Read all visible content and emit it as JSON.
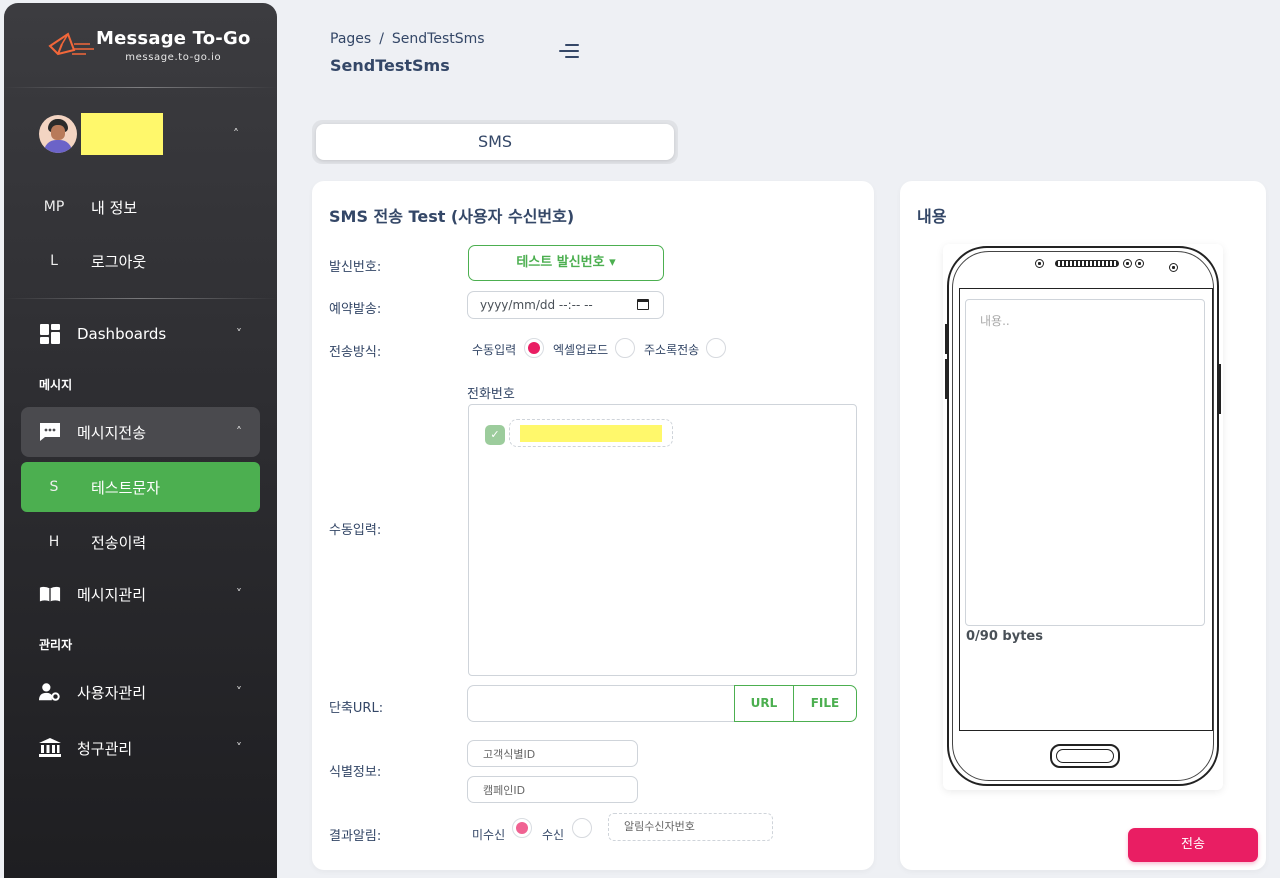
{
  "brand": {
    "title": "Message To-Go",
    "subtitle": "message.to-go.io"
  },
  "sidebar": {
    "user_subitems": [
      {
        "abbr": "MP",
        "label": "내 정보"
      },
      {
        "abbr": "L",
        "label": "로그아웃"
      }
    ],
    "dashboards": "Dashboards",
    "section_message": "메시지",
    "message_send": "메시지전송",
    "message_send_subitems": [
      {
        "abbr": "S",
        "label": "테스트문자"
      },
      {
        "abbr": "H",
        "label": "전송이력"
      }
    ],
    "message_manage": "메시지관리",
    "section_admin": "관리자",
    "user_manage": "사용자관리",
    "billing_manage": "청구관리"
  },
  "header": {
    "breadcrumb_root": "Pages",
    "breadcrumb_sep": "/",
    "breadcrumb_current": "SendTestSms",
    "title": "SendTestSms"
  },
  "tabs": [
    "SMS"
  ],
  "form": {
    "title": "SMS 전송 Test (사용자 수신번호)",
    "sender_label": "발신번호:",
    "sender_button": "테스트 발신번호 ▾",
    "reserve_label": "예약발송:",
    "reserve_value": "yyyy/mm/dd --:-- --",
    "method_label": "전송방식:",
    "method_options": [
      "수동입력",
      "엑셀업로드",
      "주소록전송"
    ],
    "method_selected": "수동입력",
    "phone_header": "전화번호",
    "manual_label": "수동입력:",
    "url_label": "단축URL:",
    "url_button": "URL",
    "file_button": "FILE",
    "ident_label": "식별정보:",
    "customer_id_placeholder": "고객식별ID",
    "campaign_id_placeholder": "캠페인ID",
    "result_label": "결과알림:",
    "result_options": [
      "미수신",
      "수신"
    ],
    "result_selected": "미수신",
    "notify_placeholder": "알림수신자번호"
  },
  "content": {
    "title": "내용",
    "placeholder": "내용..",
    "bytes": "0/90 bytes",
    "send_button": "전송"
  },
  "colors": {
    "accent": "#e91e63",
    "green": "#4caf50",
    "text": "#344767"
  }
}
